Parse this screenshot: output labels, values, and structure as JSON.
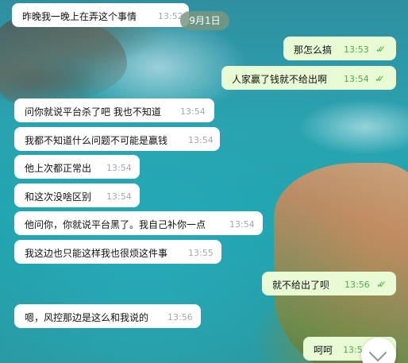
{
  "date_divider": "9月1日",
  "messages": [
    {
      "text": "昨晚我一晚上在弄这个事情",
      "time": "13:52"
    },
    {
      "text": "那怎么搞",
      "time": "13:53",
      "ticks": "✓✓"
    },
    {
      "text": "人家赢了钱就不给出啊",
      "time": "13:54",
      "ticks": "✓✓"
    },
    {
      "text": "问你就说平台杀了吧 我也不知道",
      "time": "13:54"
    },
    {
      "text": "我都不知道什么问题不可能是赢钱",
      "time": "13:54"
    },
    {
      "text": "他上次都正常出",
      "time": "13:54"
    },
    {
      "text": "和这次没啥区别",
      "time": "13:54"
    },
    {
      "text": "他问你，你就说平台黑了。我自己补你一点",
      "time": "13:54"
    },
    {
      "text": "我这边也只能这样我也很烦这件事",
      "time": "13:55"
    },
    {
      "text": "就不给出了呗",
      "time": "13:56",
      "ticks": "✓✓"
    },
    {
      "text": "嗯，风控那边是这么和我说的",
      "time": "13:56"
    },
    {
      "text": "呵呵",
      "time": "13:5"
    }
  ],
  "scroll_button_icon": "chevron-down-icon"
}
